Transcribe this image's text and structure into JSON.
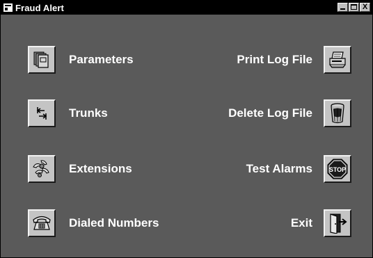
{
  "window": {
    "title": "Fraud Alert",
    "close_glyph": "X"
  },
  "menu": {
    "left": [
      {
        "label": "Parameters",
        "icon": "documents-icon"
      },
      {
        "label": "Trunks",
        "icon": "trunks-icon"
      },
      {
        "label": "Extensions",
        "icon": "extensions-icon"
      },
      {
        "label": "Dialed Numbers",
        "icon": "telephone-icon"
      }
    ],
    "right": [
      {
        "label": "Print Log File",
        "icon": "printer-icon"
      },
      {
        "label": "Delete Log File",
        "icon": "trash-can-icon"
      },
      {
        "label": "Test Alarms",
        "icon": "stop-sign-icon"
      },
      {
        "label": "Exit",
        "icon": "exit-door-icon"
      }
    ]
  },
  "icons": {
    "stop_text": "STOP"
  },
  "colors": {
    "background": "#5a5a5a",
    "titlebar": "#000000",
    "button_face": "#c4c4c4",
    "text": "#ffffff"
  }
}
